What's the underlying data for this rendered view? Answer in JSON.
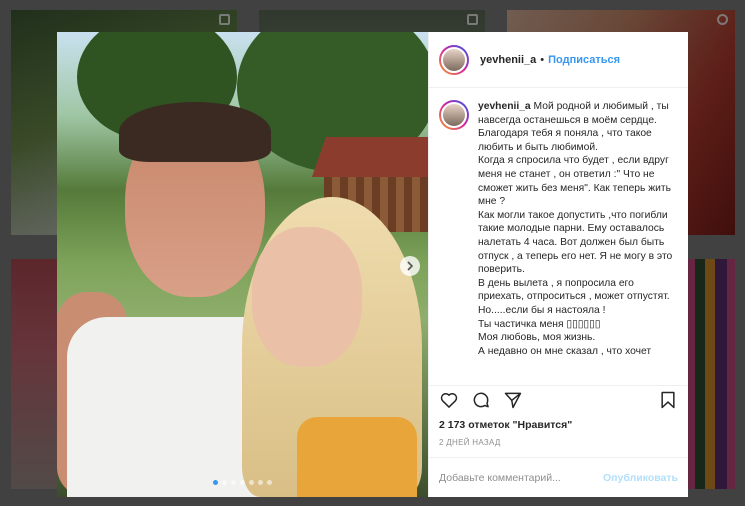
{
  "profile": {
    "username": "yevhenii_a",
    "separator": "•",
    "follow_label": "Подписаться"
  },
  "caption": {
    "username": "yevhenii_a",
    "text": " Мой родной и любимый , ты навсегда останешься в моём сердце.\nБлагодаря тебя я поняла , что такое любить и быть любимой.\nКогда я спросила что будет , если вдруг меня не станет , он ответил :\" Что не сможет жить без меня\". Как теперь жить мне ?\nКак могли такое допустить ,что погибли такие молодые парни. Ему оставалось налетать 4 часа. Вот должен был быть отпуск , а теперь его нет. Я не могу в это поверить.\nВ день вылета , я попросила его приехать, отпроситься , может отпустят. Но.....если бы я настояла !\nТы частичка меня ▯▯▯▯▯▯\nМоя любовь, моя жизнь.\nА недавно он мне сказал , что хочет"
  },
  "post": {
    "likes_text": "2 173 отметок \"Нравится\"",
    "date_text": "2 ДНЕЙ НАЗАД"
  },
  "comment": {
    "placeholder": "Добавьте комментарий...",
    "publish_label": "Опубликовать"
  },
  "carousel": {
    "total": 7,
    "active_index": 0,
    "next_icon": "chevron-right-icon"
  },
  "icons": {
    "like": "heart-icon",
    "comment": "comment-icon",
    "share": "share-icon",
    "save": "bookmark-icon"
  },
  "colors": {
    "accent": "#3897f0",
    "publish_disabled": "#b2dffc",
    "secondary_text": "#8e8e8e"
  }
}
